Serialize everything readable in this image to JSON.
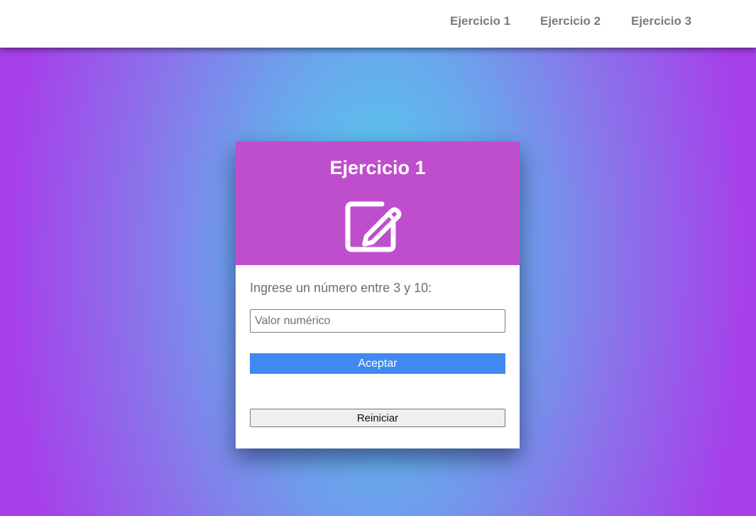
{
  "nav": {
    "links": [
      {
        "label": "Ejercicio 1"
      },
      {
        "label": "Ejercicio 2"
      },
      {
        "label": "Ejercicio 3"
      }
    ]
  },
  "card": {
    "title": "Ejercicio 1",
    "icon": "edit-icon",
    "prompt": "Ingrese un número entre 3 y 10:",
    "input": {
      "value": "",
      "placeholder": "Valor numérico"
    },
    "accept_label": "Aceptar",
    "reset_label": "Reiniciar"
  },
  "colors": {
    "header": "#bf4ecd",
    "accent_button": "#4189f0",
    "nav_text": "#7a7a7a",
    "background_center": "#4ed8ee",
    "background_edge": "#a640ea"
  }
}
